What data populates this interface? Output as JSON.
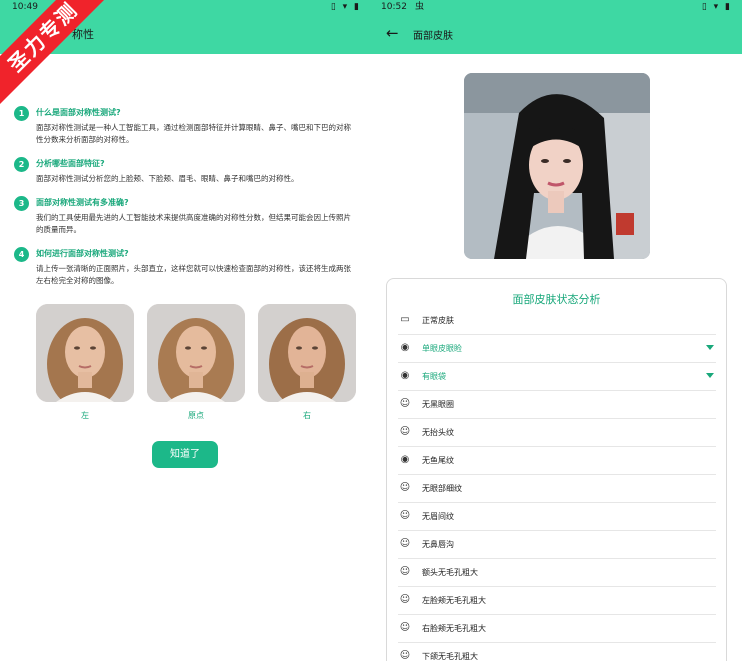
{
  "left": {
    "status_time": "10:49",
    "status_icons": "▯ ▾ ▮",
    "app_title": "称性",
    "ribbon": "圣力专测",
    "qa": [
      {
        "num": "1",
        "q": "什么是面部对称性测试?",
        "a": "面部对称性测试是一种人工智能工具，通过检测面部特征并计算眼睛、鼻子、嘴巴和下巴的对称性分数来分析面部的对称性。"
      },
      {
        "num": "2",
        "q": "分析哪些面部特征?",
        "a": "面部对称性测试分析您的上脸颊、下脸颊、眉毛、眼睛、鼻子和嘴巴的对称性。"
      },
      {
        "num": "3",
        "q": "面部对称性测试有多准确?",
        "a": "我们的工具使用最先进的人工智能技术来提供高度准确的对称性分数，但结果可能会因上传照片的质量而异。"
      },
      {
        "num": "4",
        "q": "如何进行面部对称性测试?",
        "a": "请上传一张清晰的正面照片，头部直立，这样您就可以快速检查面部的对称性，该还将生成两张左右检完全对称的图像。"
      }
    ],
    "faces": [
      "左",
      "原点",
      "右"
    ],
    "ok_button": "知道了"
  },
  "right": {
    "status_time": "10:52",
    "status_extra": "虫",
    "status_icons": "▯ ▾ ▮",
    "back_icon": "arrow-left-icon",
    "app_title": "面部皮肤",
    "card_title": "面部皮肤状态分析",
    "rows": [
      {
        "icon": "▭",
        "label": "正常皮肤",
        "expandable": false
      },
      {
        "icon": "◉",
        "label": "单眼皮眼睑",
        "expandable": true
      },
      {
        "icon": "◉",
        "label": "有眼袋",
        "expandable": true
      },
      {
        "icon": "☺",
        "label": "无黑眼圈",
        "expandable": false
      },
      {
        "icon": "☺",
        "label": "无抬头纹",
        "expandable": false
      },
      {
        "icon": "◉",
        "label": "无鱼尾纹",
        "expandable": false
      },
      {
        "icon": "☺",
        "label": "无眼部细纹",
        "expandable": false
      },
      {
        "icon": "☺",
        "label": "无眉间纹",
        "expandable": false
      },
      {
        "icon": "☺",
        "label": "无鼻唇沟",
        "expandable": false
      },
      {
        "icon": "☺",
        "label": "额头无毛孔粗大",
        "expandable": false
      },
      {
        "icon": "☺",
        "label": "左脸颊无毛孔粗大",
        "expandable": false
      },
      {
        "icon": "☺",
        "label": "右脸颊无毛孔粗大",
        "expandable": false
      },
      {
        "icon": "☺",
        "label": "下颌无毛孔粗大",
        "expandable": false
      }
    ]
  },
  "colors": {
    "accent": "#1cb889",
    "bar": "#3ed8a3",
    "ribbon": "#f0232b"
  }
}
